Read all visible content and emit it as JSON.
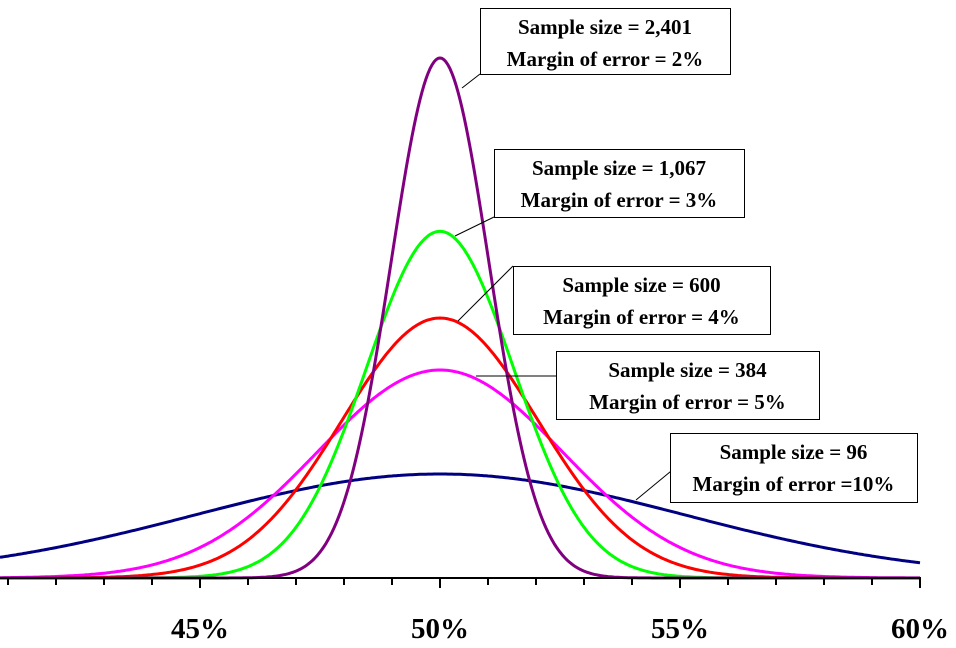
{
  "chart_data": {
    "type": "line",
    "title": "",
    "xlabel": "",
    "ylabel": "",
    "xlim": [
      40.83,
      60
    ],
    "x_ticks_major": [
      "45%",
      "50%",
      "55%",
      "60%"
    ],
    "x_tick_values_major": [
      45,
      50,
      55,
      60
    ],
    "x_minor_tick_step": 1,
    "grid": false,
    "legend": "none (callout labels)",
    "distribution": "normal sampling distributions centered at 50%, sigma = margin_of_error / 1.96",
    "series": [
      {
        "name": "Sample size = 2,401",
        "sample_size": 2401,
        "margin_of_error": 2,
        "color": "#800080",
        "label_line1": "Sample size = 2,401",
        "label_line2": "Margin of error = 2%"
      },
      {
        "name": "Sample size = 1,067",
        "sample_size": 1067,
        "margin_of_error": 3,
        "color": "#00ff00",
        "label_line1": "Sample size = 1,067",
        "label_line2": "Margin of error = 3%"
      },
      {
        "name": "Sample size = 600",
        "sample_size": 600,
        "margin_of_error": 4,
        "color": "#ff0000",
        "label_line1": "Sample size = 600",
        "label_line2": "Margin of error = 4%"
      },
      {
        "name": "Sample size = 384",
        "sample_size": 384,
        "margin_of_error": 5,
        "color": "#ff00ff",
        "label_line1": "Sample size = 384",
        "label_line2": "Margin of error = 5%"
      },
      {
        "name": "Sample size = 96",
        "sample_size": 96,
        "margin_of_error": 10,
        "color": "#000080",
        "label_line1": "Sample size = 96",
        "label_line2": "Margin of error =10%"
      }
    ],
    "center": 50
  }
}
